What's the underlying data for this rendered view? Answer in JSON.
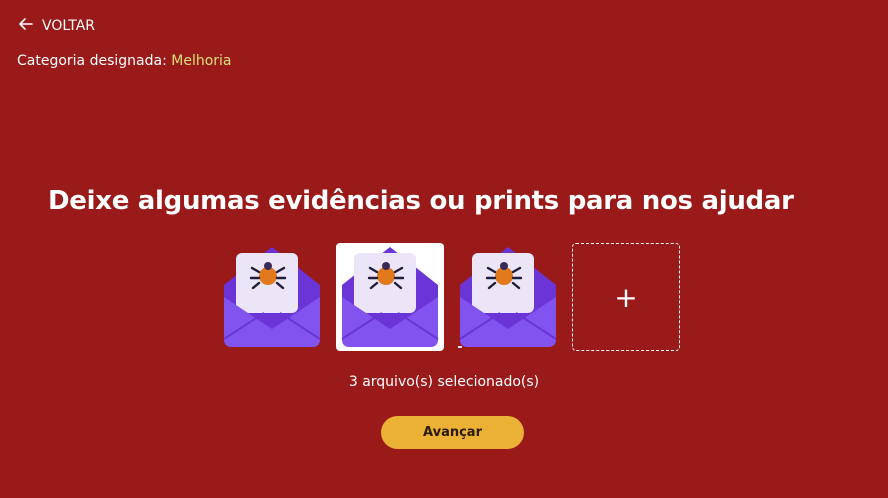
{
  "nav": {
    "back_label": "VOLTAR",
    "back_icon": "arrow-left-icon"
  },
  "category": {
    "label": "Categoria designada:",
    "value": "Melhoria",
    "value_color": "#d7e07a"
  },
  "main": {
    "title": "Deixe algumas evidências ou prints para nos ajudar"
  },
  "attachments": {
    "files": [
      {
        "icon": "bug-envelope-icon",
        "background": "transparent"
      },
      {
        "icon": "bug-envelope-icon",
        "background": "white"
      },
      {
        "icon": "bug-envelope-icon",
        "background": "transparent"
      }
    ],
    "add_icon": "plus-icon",
    "add_label": "+"
  },
  "status": {
    "text": "3 arquivo(s) selecionado(s)"
  },
  "actions": {
    "next_label": "Avançar",
    "next_color": "#eab135"
  },
  "theme": {
    "background": "#9a1a1a",
    "envelope": "#7b44e0"
  }
}
